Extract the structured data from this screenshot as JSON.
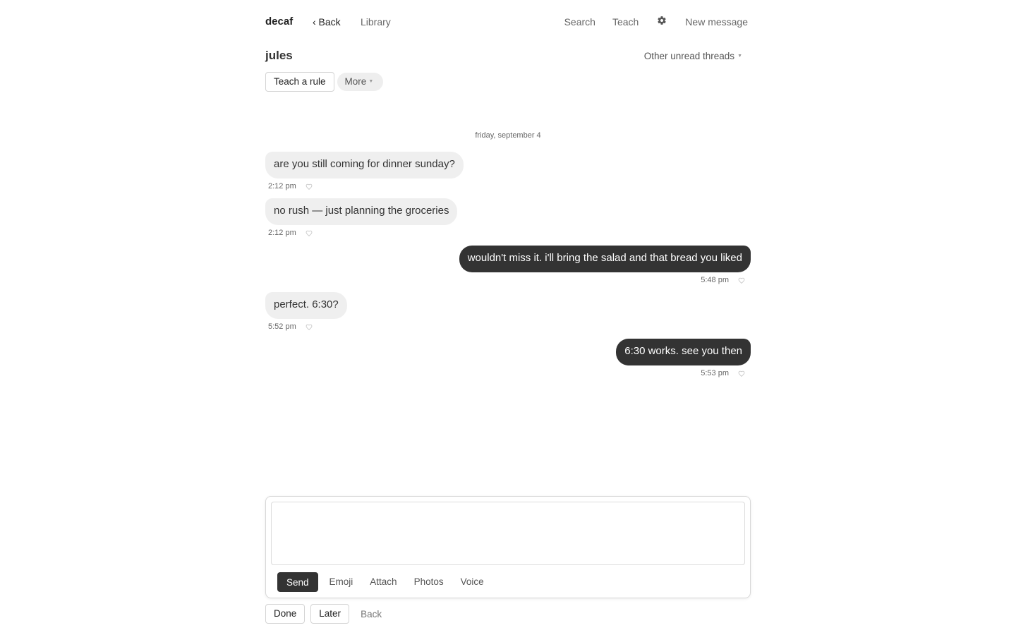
{
  "nav": {
    "brand": "decaf",
    "back": "‹ Back",
    "library": "Library",
    "search": "Search",
    "teach": "Teach",
    "settings_icon": "gear-icon",
    "new_message": "New message"
  },
  "thread": {
    "title": "jules",
    "other_unread": "Other unread threads",
    "other_unread_caret": "▼",
    "teach_rule": "Teach a rule",
    "more": "More",
    "more_caret": "▼"
  },
  "conversation": {
    "date": "friday, september 4",
    "messages": [
      {
        "direction": "incoming",
        "text": "are you still coming for dinner sunday?",
        "time": "2:12 pm"
      },
      {
        "direction": "incoming",
        "text": "no rush — just planning the groceries",
        "time": "2:12 pm"
      },
      {
        "direction": "outgoing",
        "text": "wouldn't miss it. i'll bring the salad and that bread you liked",
        "time": "5:48 pm"
      },
      {
        "direction": "incoming",
        "text": "perfect. 6:30?",
        "time": "5:52 pm"
      },
      {
        "direction": "outgoing",
        "text": "6:30 works. see you then",
        "time": "5:53 pm"
      }
    ]
  },
  "composer": {
    "input_value": "",
    "placeholder": "",
    "send": "Send",
    "emoji": "Emoji",
    "attach": "Attach",
    "photos": "Photos",
    "voice": "Voice"
  },
  "footer": {
    "done": "Done",
    "later": "Later",
    "back": "Back"
  },
  "colors": {
    "outgoing_bubble": "#333333",
    "incoming_bubble": "#efefef",
    "send_button": "#333333"
  }
}
